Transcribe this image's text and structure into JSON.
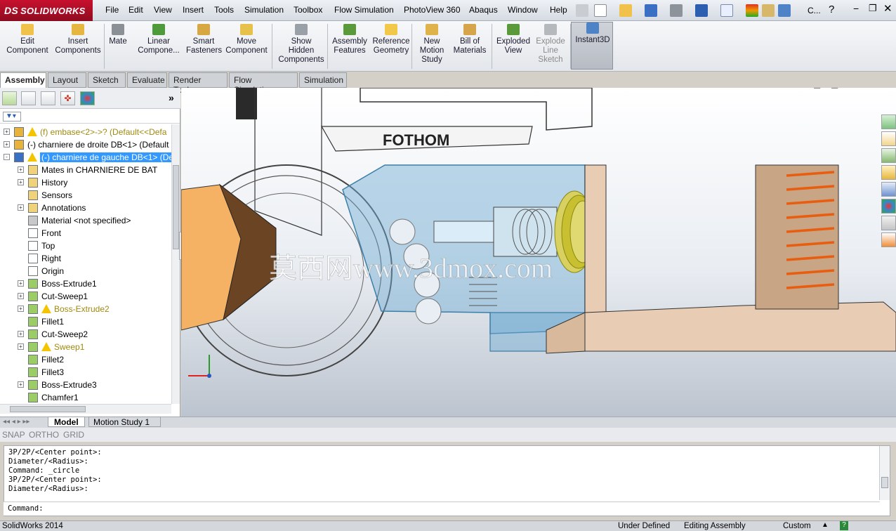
{
  "app": {
    "logo_text": "SOLIDWORKS",
    "logo_mark": "DS"
  },
  "menu": [
    "File",
    "Edit",
    "View",
    "Insert",
    "Tools",
    "Simulation",
    "Toolbox",
    "Flow Simulation",
    "PhotoView 360",
    "Abaqus",
    "Window",
    "Help"
  ],
  "quick_toolbar": {
    "overflow_label": "C..."
  },
  "command_manager": [
    {
      "label": "Edit\nComponent",
      "icon": "edit-component-icon"
    },
    {
      "label": "Insert\nComponents",
      "icon": "insert-components-icon"
    },
    {
      "label": "Mate",
      "icon": "mate-icon"
    },
    {
      "label": "Linear\nCompone...",
      "icon": "linear-pattern-icon"
    },
    {
      "label": "Smart\nFasteners",
      "icon": "smart-fasteners-icon"
    },
    {
      "label": "Move\nComponent",
      "icon": "move-component-icon"
    },
    {
      "label": "Show\nHidden\nComponents",
      "icon": "show-hidden-icon"
    },
    {
      "label": "Assembly\nFeatures",
      "icon": "assembly-features-icon"
    },
    {
      "label": "Reference\nGeometry",
      "icon": "reference-geometry-icon"
    },
    {
      "label": "New\nMotion\nStudy",
      "icon": "motion-study-icon"
    },
    {
      "label": "Bill of\nMaterials",
      "icon": "bom-icon"
    },
    {
      "label": "Exploded\nView",
      "icon": "exploded-view-icon"
    },
    {
      "label": "Explode\nLine\nSketch",
      "icon": "explode-line-icon",
      "disabled": true
    },
    {
      "label": "Instant3D",
      "icon": "instant3d-icon",
      "active": true
    }
  ],
  "tabs": [
    "Assembly",
    "Layout",
    "Sketch",
    "Evaluate",
    "Render Tools",
    "Flow Simulation",
    "Simulation"
  ],
  "active_tab": "Assembly",
  "tree": [
    {
      "label": "(f) embase<2>->? (Default<<Defa",
      "level": 0,
      "warn": true,
      "expander": "+"
    },
    {
      "label": "(-) charniere de droite DB<1> (Default",
      "level": 0,
      "warn": false,
      "expander": "+"
    },
    {
      "label": "(-) charniere de gauche DB<1> (De",
      "level": 0,
      "warn": true,
      "expander": "-",
      "selected": true
    },
    {
      "label": "Mates in CHARNIERE DE BAT",
      "level": 1,
      "expander": "+"
    },
    {
      "label": "History",
      "level": 1,
      "expander": "+"
    },
    {
      "label": "Sensors",
      "level": 1
    },
    {
      "label": "Annotations",
      "level": 1,
      "expander": "+"
    },
    {
      "label": "Material <not specified>",
      "level": 1
    },
    {
      "label": "Front",
      "level": 1
    },
    {
      "label": "Top",
      "level": 1
    },
    {
      "label": "Right",
      "level": 1
    },
    {
      "label": "Origin",
      "level": 1
    },
    {
      "label": "Boss-Extrude1",
      "level": 1,
      "expander": "+"
    },
    {
      "label": "Cut-Sweep1",
      "level": 1,
      "expander": "+"
    },
    {
      "label": "Boss-Extrude2",
      "level": 1,
      "expander": "+",
      "warn": true
    },
    {
      "label": "Fillet1",
      "level": 1
    },
    {
      "label": "Cut-Sweep2",
      "level": 1,
      "expander": "+"
    },
    {
      "label": "Sweep1",
      "level": 1,
      "expander": "+",
      "warn": true
    },
    {
      "label": "Fillet2",
      "level": 1
    },
    {
      "label": "Fillet3",
      "level": 1
    },
    {
      "label": "Boss-Extrude3",
      "level": 1,
      "expander": "+"
    },
    {
      "label": "Chamfer1",
      "level": 1
    }
  ],
  "viewport": {
    "part_label": "FOTHOM",
    "watermark": "莫西网www.3dmox.com"
  },
  "bottom_tabs": [
    "Model",
    "Motion Study 1"
  ],
  "snap": [
    "SNAP",
    "ORTHO",
    "GRID"
  ],
  "console_lines": [
    "3P/2P/<Center point>:",
    "Diameter/<Radius>:",
    "Command: _circle",
    "3P/2P/<Center point>:",
    "Diameter/<Radius>:"
  ],
  "command_prompt": "Command:",
  "status": {
    "left": "SolidWorks 2014",
    "defined": "Under Defined",
    "mode": "Editing Assembly",
    "units": "Custom"
  }
}
